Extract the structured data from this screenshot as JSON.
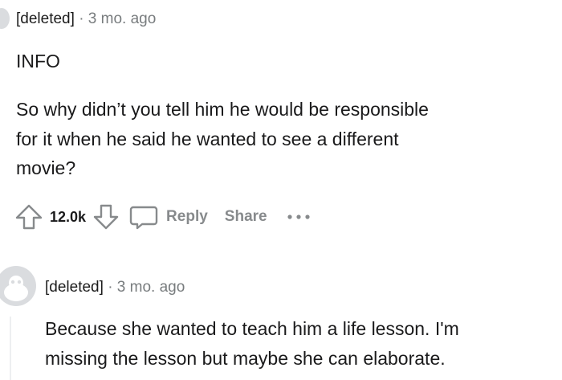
{
  "comment1": {
    "username": "[deleted]",
    "separator": "·",
    "time": "3 mo. ago",
    "tag": "INFO",
    "lines": [
      "So why didn’t you tell him he would be responsible",
      "for it when he said he wanted to see a different",
      "movie?"
    ],
    "score": "12.0k",
    "reply_label": "Reply",
    "share_label": "Share"
  },
  "comment2": {
    "username": "[deleted]",
    "separator": "·",
    "time": "3 mo. ago",
    "lines": [
      "Because she wanted to teach him a life lesson. I'm",
      "missing the lesson but maybe she can elaborate."
    ]
  }
}
